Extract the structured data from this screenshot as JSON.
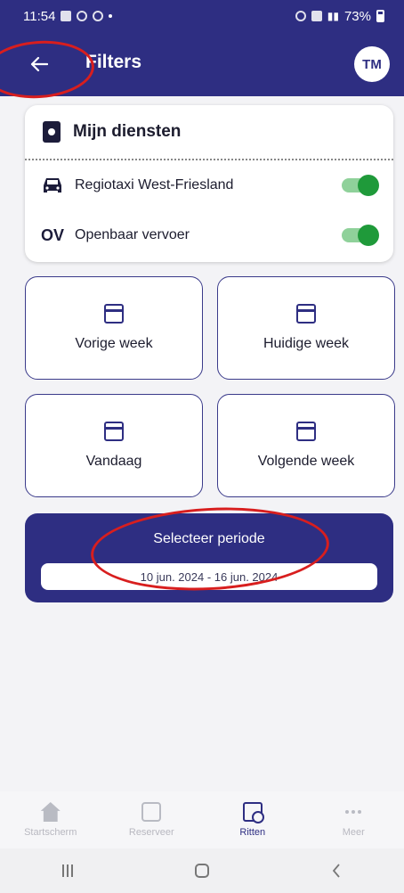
{
  "status_bar": {
    "time": "11:54",
    "battery": "73%"
  },
  "app_bar": {
    "title": "Filters",
    "avatar_initials": "TM"
  },
  "services": {
    "title": "Mijn diensten",
    "items": [
      {
        "icon": "taxi-icon",
        "label": "Regiotaxi West-Friesland",
        "enabled": true
      },
      {
        "icon_text": "OV",
        "label": "Openbaar vervoer",
        "enabled": true
      }
    ]
  },
  "quick_filters": [
    {
      "label": "Vorige week"
    },
    {
      "label": "Huidige week"
    },
    {
      "label": "Vandaag"
    },
    {
      "label": "Volgende week"
    }
  ],
  "period": {
    "title": "Selecteer periode",
    "value": "10 jun. 2024 - 16 jun. 2024"
  },
  "bottom_nav": [
    {
      "label": "Startscherm",
      "active": false
    },
    {
      "label": "Reserveer",
      "active": false
    },
    {
      "label": "Ritten",
      "active": true
    },
    {
      "label": "Meer",
      "active": false
    }
  ],
  "colors": {
    "primary": "#2e2e82",
    "toggle_on": "#1f9a3a",
    "annotation": "#d81e1e"
  }
}
